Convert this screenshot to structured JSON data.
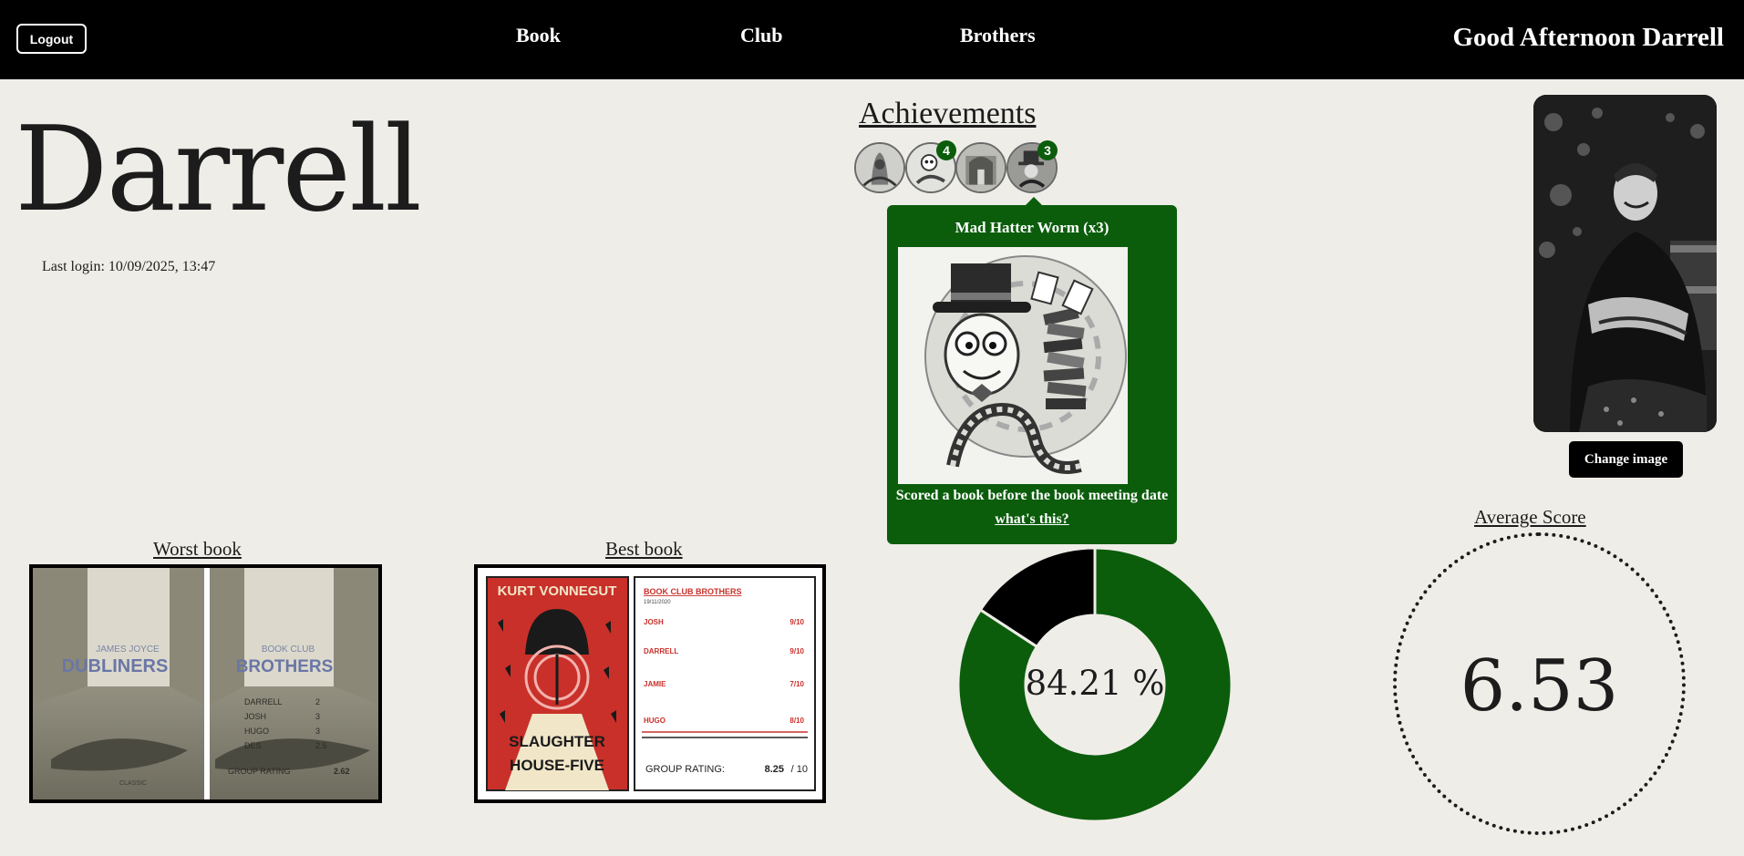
{
  "header": {
    "logout_label": "Logout",
    "nav": [
      "Book",
      "Club",
      "Brothers"
    ],
    "greeting": "Good Afternoon Darrell"
  },
  "profile": {
    "name": "Darrell",
    "last_login": "Last login: 10/09/2025, 13:47",
    "change_image_label": "Change image"
  },
  "achievements": {
    "title": "Achievements",
    "badges": [
      {
        "icon": "worm-knight-badge-icon",
        "count": null
      },
      {
        "icon": "worm-scholar-badge-icon",
        "count": "4"
      },
      {
        "icon": "library-badge-icon",
        "count": null
      },
      {
        "icon": "mad-hatter-worm-badge-icon",
        "count": "3"
      }
    ],
    "tooltip": {
      "title": "Mad Hatter Worm (x3)",
      "description": "Scored a book before the book meeting date",
      "link": "what's this?"
    }
  },
  "worst_book": {
    "title": "Worst book",
    "cover": {
      "author": "JAMES JOYCE",
      "book": "DUBLINERS",
      "publisher": "CLASSIC"
    },
    "card": {
      "heading_top": "BOOK CLUB",
      "heading": "BROTHERS",
      "ratings": [
        {
          "name": "DARRELL",
          "score": "2"
        },
        {
          "name": "JOSH",
          "score": "3"
        },
        {
          "name": "HUGO",
          "score": "3"
        },
        {
          "name": "DES",
          "score": "2.5"
        }
      ],
      "group_label": "GROUP RATING",
      "group_value": "2.62"
    }
  },
  "best_book": {
    "title": "Best book",
    "cover": {
      "author": "KURT VONNEGUT",
      "book_line1": "SLAUGHTER",
      "book_line2": "HOUSE-FIVE"
    },
    "card": {
      "heading": "BOOK CLUB BROTHERS",
      "date": "19/11/2020",
      "ratings": [
        {
          "name": "JOSH",
          "score": "9/10"
        },
        {
          "name": "DARRELL",
          "score": "9/10"
        },
        {
          "name": "JAMIE",
          "score": "7/10"
        },
        {
          "name": "HUGO",
          "score": "8/10"
        }
      ],
      "group_label": "GROUP RATING:",
      "group_value": "8.25",
      "group_suffix": "/ 10"
    }
  },
  "completion": {
    "label": "84.21 %",
    "value": 84.21,
    "colors": {
      "filled": "#0b5d0c",
      "empty": "#000000"
    }
  },
  "average_score": {
    "title": "Average Score",
    "value": "6.53"
  },
  "colors": {
    "accent": "#0b5d0c",
    "background": "#efede7",
    "topbar": "#000000"
  }
}
